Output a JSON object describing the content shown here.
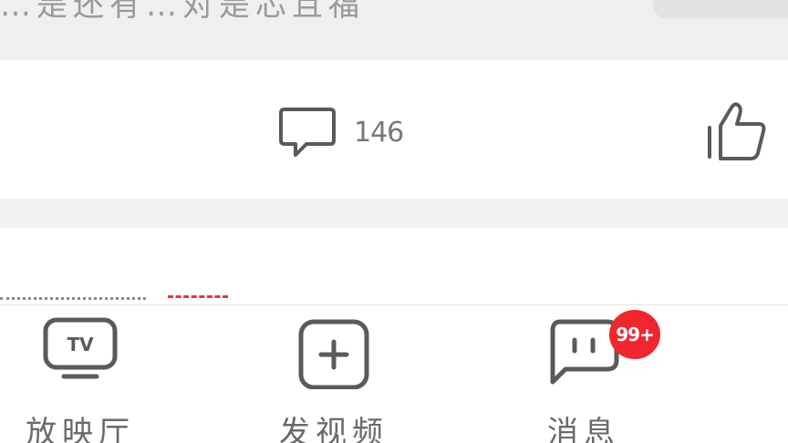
{
  "previous_card": {
    "partial_text": "…是还有…对是芯且福"
  },
  "actions": {
    "comment_count": "146"
  },
  "icons": {
    "comment": "comment-bubble-icon",
    "like": "thumbs-up-icon",
    "cinema": "tv-icon",
    "post": "plus-square-icon",
    "message": "chat-bubble-icon"
  },
  "tab_bar": {
    "tabs": [
      {
        "label": "放映厅"
      },
      {
        "label": "发视频"
      },
      {
        "label": "消息"
      }
    ],
    "message_badge": "99+"
  },
  "colors": {
    "badge": "#f0252e",
    "icon": "#5a5a5a",
    "label": "#6a6a6a"
  }
}
